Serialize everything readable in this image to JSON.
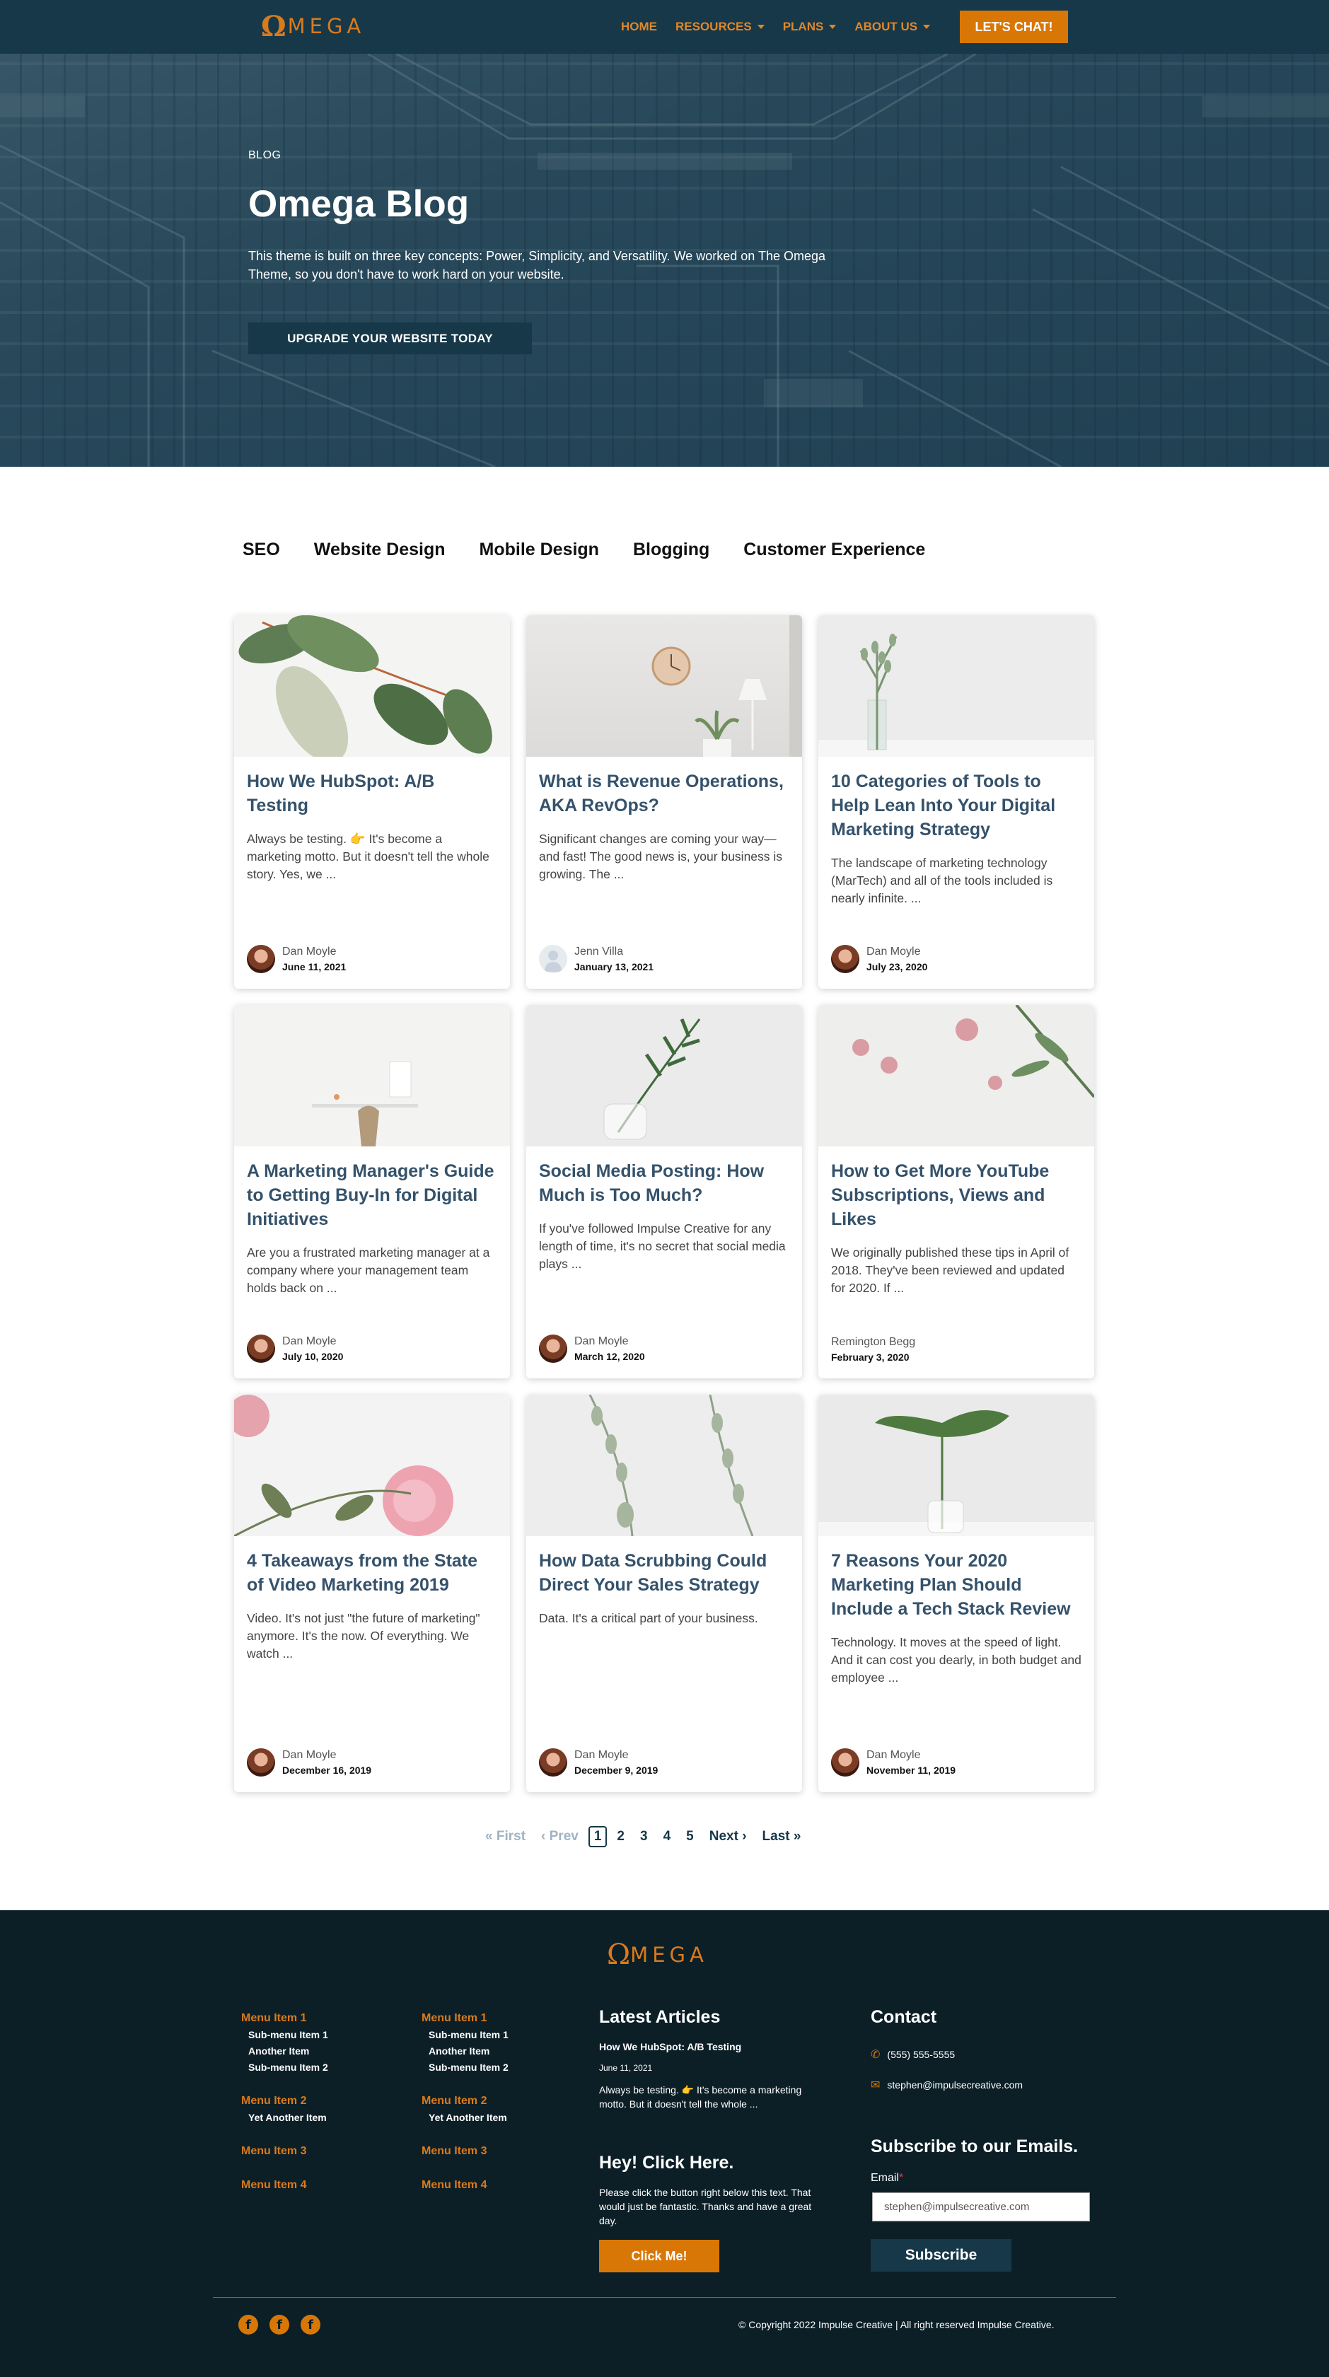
{
  "header": {
    "logo_omega": "Ω",
    "logo_rest": "MEGA",
    "nav": [
      {
        "label": "HOME",
        "dropdown": false
      },
      {
        "label": "RESOURCES",
        "dropdown": true
      },
      {
        "label": "PLANS",
        "dropdown": true
      },
      {
        "label": "ABOUT US",
        "dropdown": true
      }
    ],
    "cta": "LET'S CHAT!"
  },
  "hero": {
    "kicker": "BLOG",
    "title": "Omega Blog",
    "text": "This theme is built on three key concepts: Power, Simplicity, and Versatility. We worked on The Omega Theme, so you don't have to work hard on your website.",
    "button": "UPGRADE YOUR WEBSITE TODAY"
  },
  "tabs": [
    "SEO",
    "Website Design",
    "Mobile Design",
    "Blogging",
    "Customer Experience"
  ],
  "posts": [
    {
      "title": "How We HubSpot: A/B Testing",
      "excerpt": "Always be testing. 👉 It's become a marketing motto. But it doesn't tell the whole story. Yes, we ...",
      "author": "Dan Moyle",
      "date": "June 11, 2021",
      "avatar": "photo"
    },
    {
      "title": "What is Revenue Operations, AKA RevOps?",
      "excerpt": "Significant changes are coming your way— and fast! The good news is, your business is growing. The ...",
      "author": "Jenn Villa",
      "date": "January 13, 2021",
      "avatar": "blank"
    },
    {
      "title": "10 Categories of Tools to Help Lean Into Your Digital Marketing Strategy",
      "excerpt": "The landscape of marketing technology (MarTech) and all of the tools included is nearly infinite. ...",
      "author": "Dan Moyle",
      "date": "July 23, 2020",
      "avatar": "photo"
    },
    {
      "title": "A Marketing Manager's Guide to Getting Buy-In for Digital Initiatives",
      "excerpt": "Are you a frustrated marketing manager at a company where your management team holds back on ...",
      "author": "Dan Moyle",
      "date": "July 10, 2020",
      "avatar": "photo"
    },
    {
      "title": "Social Media Posting: How Much is Too Much?",
      "excerpt": "If you've followed Impulse Creative for any length of time, it's no secret that social media plays ...",
      "author": "Dan Moyle",
      "date": "March 12, 2020",
      "avatar": "photo"
    },
    {
      "title": "How to Get More YouTube Subscriptions, Views and Likes",
      "excerpt": "We originally published these tips in April of 2018. They've been reviewed and updated for 2020. If ...",
      "author": "Remington Begg",
      "date": "February 3, 2020",
      "avatar": "none"
    },
    {
      "title": "4 Takeaways from the State of Video Marketing 2019",
      "excerpt": "Video. It's not just \"the future of marketing\" anymore. It's the now. Of everything.  We watch ...",
      "author": "Dan Moyle",
      "date": "December 16, 2019",
      "avatar": "photo"
    },
    {
      "title": "How Data Scrubbing Could Direct Your Sales Strategy",
      "excerpt": "Data. It's a critical part of your business.",
      "author": "Dan Moyle",
      "date": "December 9, 2019",
      "avatar": "photo"
    },
    {
      "title": "7 Reasons Your 2020 Marketing Plan Should Include a Tech Stack Review",
      "excerpt": "Technology. It moves at the speed of light. And it can cost you dearly, in both budget and employee ...",
      "author": "Dan Moyle",
      "date": "November 11, 2019",
      "avatar": "photo"
    }
  ],
  "pagination": {
    "first": "« First",
    "prev": "‹ Prev",
    "pages": [
      "1",
      "2",
      "3",
      "4",
      "5"
    ],
    "current": "1",
    "next": "Next ›",
    "last": "Last »"
  },
  "footer": {
    "menus": [
      {
        "items": [
          {
            "label": "Menu Item 1",
            "subs": [
              "Sub-menu Item 1",
              "Another Item",
              "Sub-menu Item 2"
            ]
          },
          {
            "label": "Menu Item 2",
            "subs": [
              "Yet Another Item"
            ]
          },
          {
            "label": "Menu Item 3",
            "subs": []
          },
          {
            "label": "Menu Item 4",
            "subs": []
          }
        ]
      },
      {
        "items": [
          {
            "label": "Menu Item 1",
            "subs": [
              "Sub-menu Item 1",
              "Another Item",
              "Sub-menu Item 2"
            ]
          },
          {
            "label": "Menu Item 2",
            "subs": [
              "Yet Another Item"
            ]
          },
          {
            "label": "Menu Item 3",
            "subs": []
          },
          {
            "label": "Menu Item 4",
            "subs": []
          }
        ]
      }
    ],
    "latest_heading": "Latest Articles",
    "latest_title": "How We HubSpot: A/B Testing",
    "latest_date": "June 11, 2021",
    "latest_text": "Always be testing. 👉 It's become a marketing motto. But it doesn't tell the whole ...",
    "click_heading": "Hey! Click Here.",
    "click_text": "Please click the button right below this text. That would just be fantastic. Thanks and have a great day.",
    "click_button": "Click Me!",
    "contact_heading": "Contact",
    "phone": "(555) 555-5555",
    "email": "stephen@impulsecreative.com",
    "subscribe_heading": "Subscribe to our Emails.",
    "email_label": "Email",
    "email_required": "*",
    "email_value": "stephen@impulsecreative.com",
    "subscribe_button": "Subscribe",
    "copyright": "© Copyright 2022 Impulse Creative | All right reserved Impulse Creative.",
    "social": [
      "facebook-icon",
      "facebook-icon",
      "facebook-icon"
    ]
  },
  "colors": {
    "navy": "#163848",
    "orange": "#d97706",
    "footer_bg": "#0c1f27",
    "title_blue": "#35526b"
  }
}
